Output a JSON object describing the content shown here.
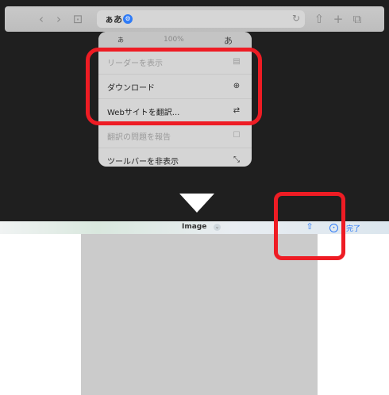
{
  "toolbar": {
    "reader_label": "ぁあ",
    "icons": [
      "back-icon",
      "forward-icon",
      "book-icon",
      "puzzle-badge-icon",
      "reload-icon",
      "share-icon",
      "plus-icon",
      "tabs-icon"
    ]
  },
  "menu": {
    "zoom_small": "あ",
    "zoom_value": "100%",
    "zoom_large": "あ",
    "items": [
      {
        "label": "リーダーを表示",
        "icon": "reader-icon",
        "enabled": false
      },
      {
        "label": "ダウンロード",
        "icon": "download-icon",
        "enabled": true
      },
      {
        "label": "Webサイトを翻訳...",
        "icon": "translate-icon",
        "enabled": true
      },
      {
        "label": "翻訳の問題を報告",
        "icon": "report-icon",
        "enabled": false
      },
      {
        "label": "ツールバーを非表示",
        "icon": "resize-arrows-icon",
        "enabled": true
      }
    ]
  },
  "viewer": {
    "title": "Image",
    "done_label": "完了"
  },
  "colors": {
    "highlight": "#ee1c24",
    "accent": "#2f7bf6",
    "image_placeholder": "#cbcbcb"
  }
}
